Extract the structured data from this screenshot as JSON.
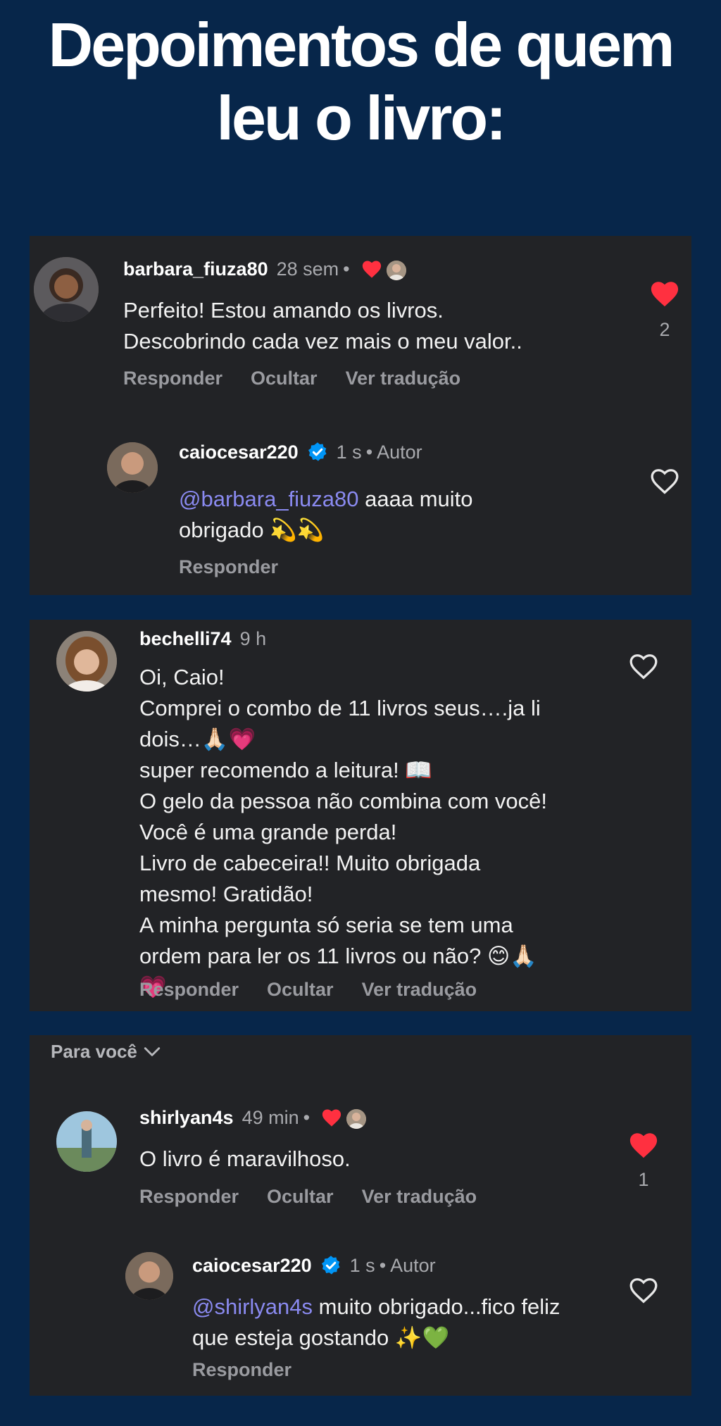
{
  "page": {
    "title": "Depoimentos de quem leu o livro:"
  },
  "comments": [
    {
      "username": "barbara_fiuza80",
      "time": "28 sem",
      "text": "Perfeito! Estou amando os livros.\nDescobrindo cada vez mais o meu valor..",
      "likes": "2",
      "liked": true,
      "actions": [
        "Responder",
        "Ocultar",
        "Ver tradução"
      ],
      "reply": {
        "username": "caiocesar220",
        "time": "1 s",
        "badge": "Autor",
        "mention": "@barbara_fiuza80",
        "text": " aaaa muito\nobrigado 💫💫",
        "action": "Responder"
      }
    },
    {
      "username": "bechelli74",
      "time": "9 h",
      "text": "Oi, Caio!\nComprei o combo de 11 livros seus….ja li\ndois…🙏🏻💗\nsuper recomendo a leitura! 📖\nO gelo da pessoa não combina com você!\nVocê é uma grande perda!\nLivro de cabeceira!! Muito obrigada\nmesmo! Gratidão!\nA minha pergunta só seria se tem uma\nordem para ler os 11 livros ou não? 😊🙏🏻\n💗",
      "actions": [
        "Responder",
        "Ocultar",
        "Ver tradução"
      ]
    },
    {
      "section_label": "Para você",
      "username": "shirlyan4s",
      "time": "49 min",
      "text": "O livro é maravilhoso.",
      "likes": "1",
      "liked": true,
      "actions": [
        "Responder",
        "Ocultar",
        "Ver tradução"
      ],
      "reply": {
        "username": "caiocesar220",
        "time": "1 s",
        "badge": "Autor",
        "mention": "@shirlyan4s",
        "text": " muito obrigado...fico feliz\nque esteja gostando ✨💚",
        "action": "Responder"
      }
    }
  ],
  "colors": {
    "background": "#07264a",
    "card": "#222326",
    "heart": "#ff3040",
    "mention": "#8a8af0",
    "verified": "#0095f6"
  }
}
